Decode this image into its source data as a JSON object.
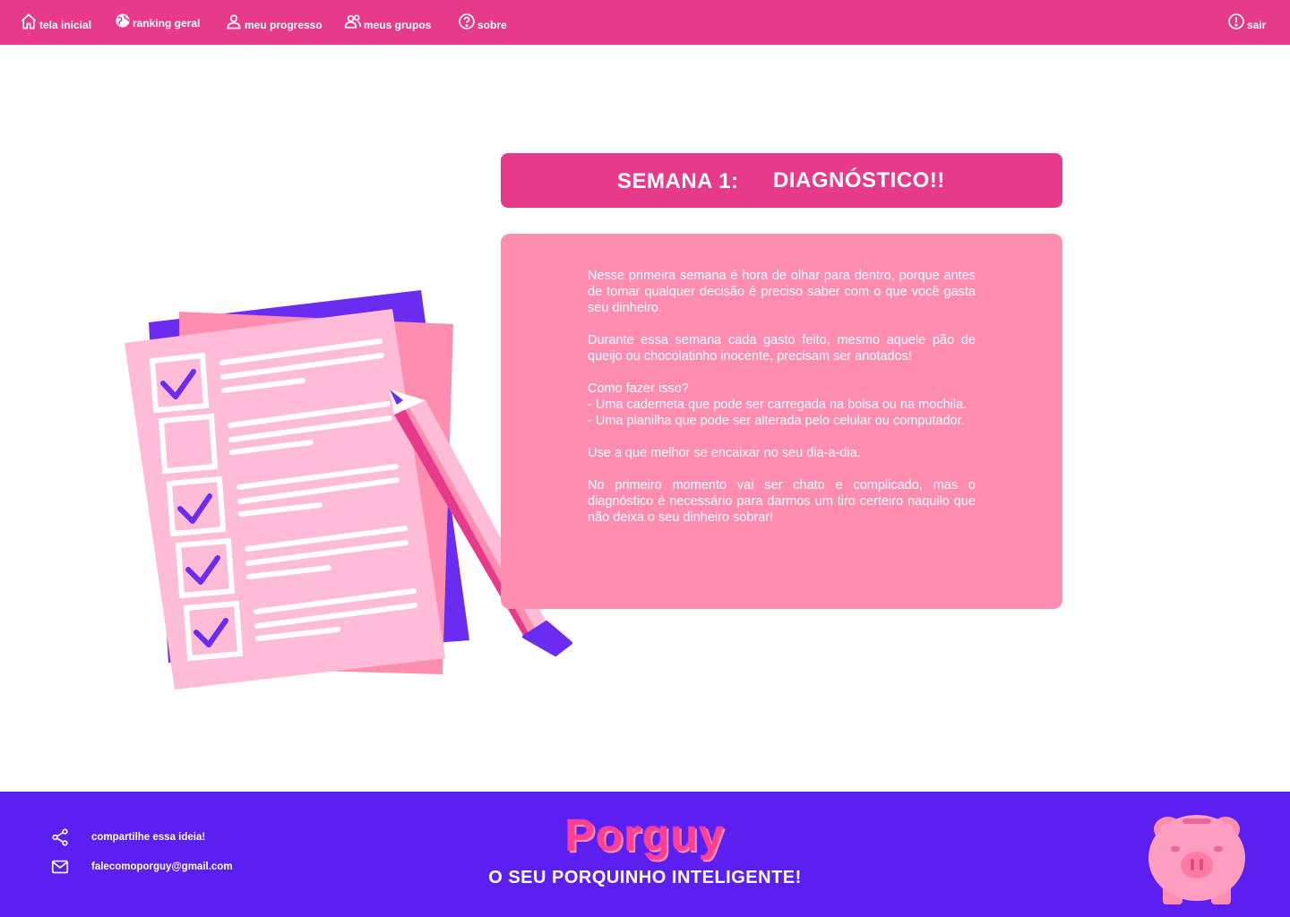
{
  "nav": {
    "items": [
      {
        "label": "tela inicial",
        "icon": "home-icon"
      },
      {
        "label": "ranking geral",
        "icon": "globe-icon"
      },
      {
        "label": "meu progresso",
        "icon": "user-icon"
      },
      {
        "label": "meus grupos",
        "icon": "group-icon"
      },
      {
        "label": "sobre",
        "icon": "help-icon"
      }
    ],
    "logout": {
      "label": "sair",
      "icon": "alert-icon"
    }
  },
  "week": {
    "number_label": "SEMANA 1:",
    "title": "DIAGNÓSTICO!!"
  },
  "content": {
    "p1": "Nesse primeira semana é hora de olhar para dentro, porque antes de tomar qualquer decisão é preciso saber com o que você gasta seu dinheiro.",
    "p2": "Durante essa semana cada gasto feito, mesmo aquele pão de queijo ou chocolatinho inocente, precisam ser anotados!",
    "p3_heading": "Como fazer isso?",
    "p3_item1": "- Uma caderneta que pode ser carregada na bolsa ou na mochila.",
    "p3_item2": "- Uma planilha que pode ser alterada pelo celular ou computador.",
    "p4": "Use a que melhor se encaixar no seu dia-a-dia.",
    "p5": "No primeiro momento vai ser chato e complicado, mas o diagnóstico é necessário para darmos um tiro certeiro naquilo que não deixa o seu dinheiro sobrar!"
  },
  "footer": {
    "share_label": "compartilhe essa ideia!",
    "email": "falecomoporguy@gmail.com",
    "brand": "Porguy",
    "tagline": "O SEU PORQUINHO INTELIGENTE!"
  },
  "colors": {
    "primary_pink": "#e83a8a",
    "card_pink": "#ff8db0",
    "footer_purple": "#5b1ff0",
    "checklist_purple": "#6a2cf0"
  }
}
